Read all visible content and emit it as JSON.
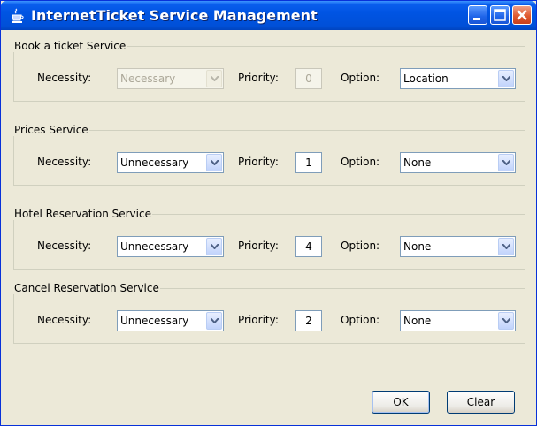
{
  "window": {
    "title": "InternetTicket Service Management",
    "icon": "java-cup-icon"
  },
  "labels": {
    "necessity": "Necessity:",
    "priority": "Priority:",
    "option": "Option:"
  },
  "services": [
    {
      "name": "Book a ticket Service",
      "necessity": "Necessary",
      "priority": "0",
      "option": "Location",
      "necessity_enabled": false
    },
    {
      "name": "Prices Service",
      "necessity": "Unnecessary",
      "priority": "1",
      "option": "None",
      "necessity_enabled": true
    },
    {
      "name": "Hotel Reservation Service",
      "necessity": "Unnecessary",
      "priority": "4",
      "option": "None",
      "necessity_enabled": true
    },
    {
      "name": "Cancel Reservation Service",
      "necessity": "Unnecessary",
      "priority": "2",
      "option": "None",
      "necessity_enabled": true
    }
  ],
  "buttons": {
    "ok": "OK",
    "clear": "Clear"
  },
  "colors": {
    "titlebar": "#0054e3",
    "background": "#ece9d8",
    "close": "#e05a30"
  }
}
